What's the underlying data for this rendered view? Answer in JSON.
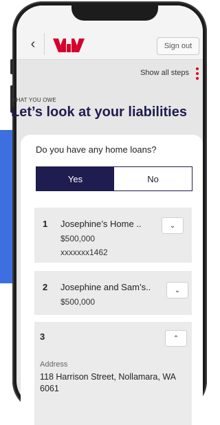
{
  "header": {
    "back_icon": "chevron-left-icon",
    "sign_out_label": "Sign out",
    "brand_color": "#d5002b"
  },
  "steps": {
    "show_all_label": "Show all steps"
  },
  "section": {
    "eyebrow": "WHAT YOU OWE",
    "title": "Let’s look at your liabilities"
  },
  "question": {
    "text": "Do you have any home loans?",
    "yes_label": "Yes",
    "no_label": "No",
    "selected": "Yes"
  },
  "loans": [
    {
      "number": "1",
      "name": "Josephine’s Home ..",
      "amount": "$500,000",
      "account": "xxxxxxx1462"
    },
    {
      "number": "2",
      "name": "Josephine and Sam’s..",
      "amount": "$500,000"
    },
    {
      "number": "3",
      "address_label": "Address",
      "address_value": "118 Harrison Street, Nollamara, WA 6061"
    }
  ],
  "colors": {
    "navy": "#1f1c4f",
    "accent_blue": "#3d6fe0",
    "brand_red": "#d5002b"
  }
}
